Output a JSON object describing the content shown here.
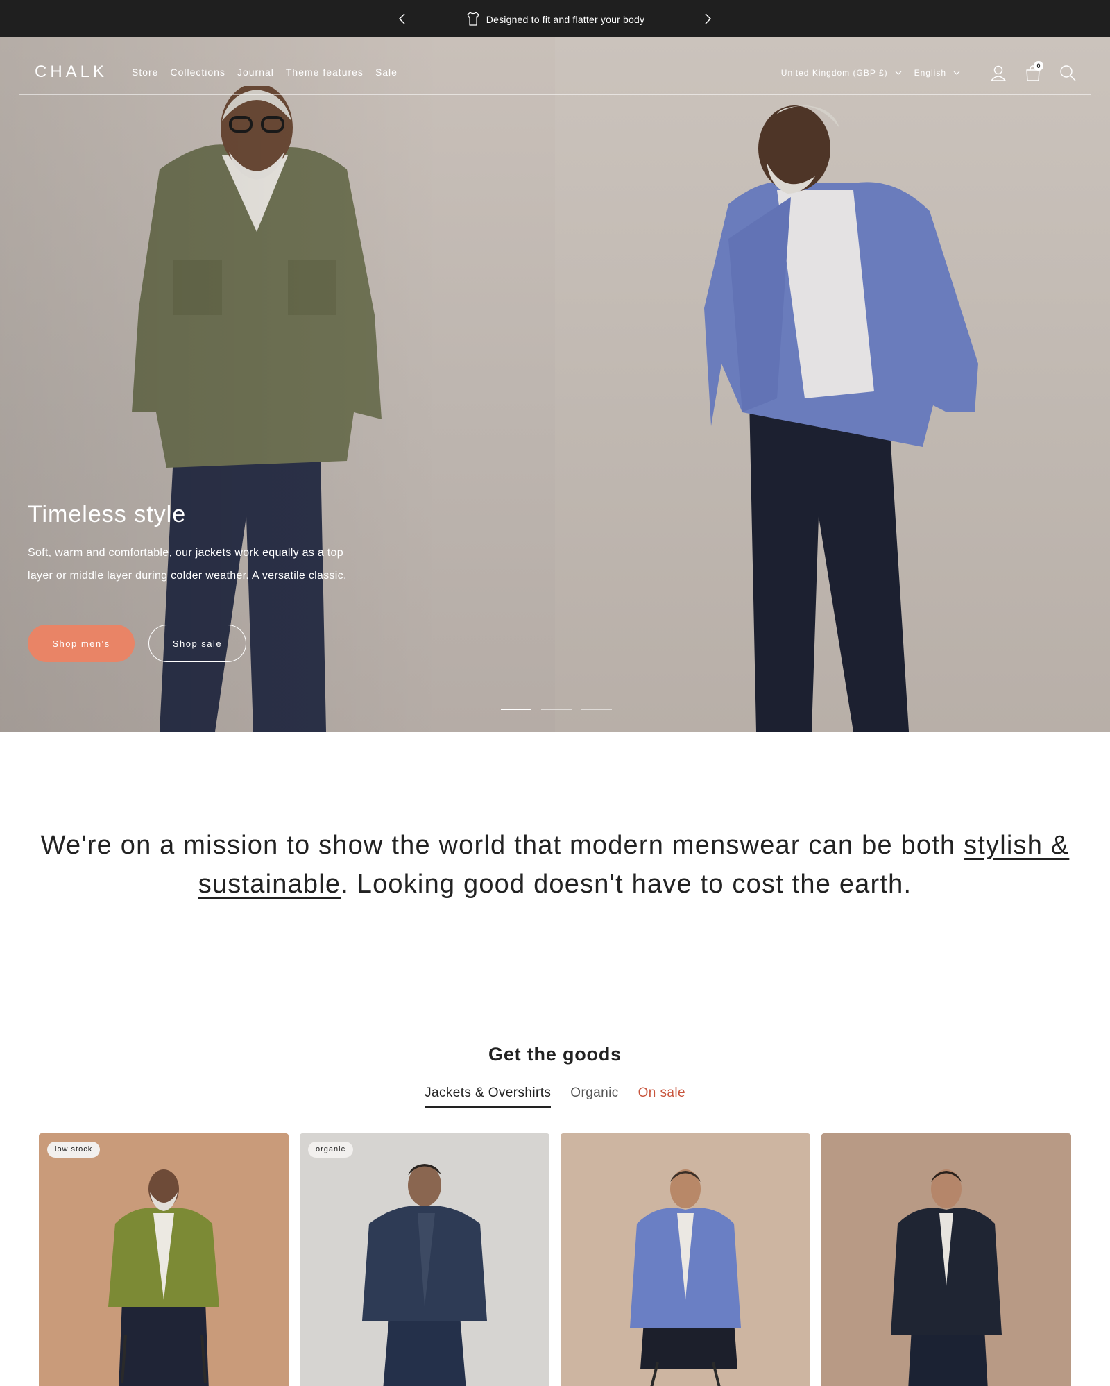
{
  "announcement": {
    "message": "Designed to fit and flatter your body",
    "icon": "tshirt-icon"
  },
  "header": {
    "logo": "CHALK",
    "nav": [
      "Store",
      "Collections",
      "Journal",
      "Theme features",
      "Sale"
    ],
    "country_selector": "United Kingdom (GBP £)",
    "language_selector": "English",
    "cart_count": "0",
    "icons": [
      "account-icon",
      "cart-icon",
      "search-icon"
    ]
  },
  "hero": {
    "title": "Timeless style",
    "description": "Soft, warm and comfortable, our jackets work equally as a top layer or middle layer during colder weather. A versatile classic.",
    "primary_button": "Shop men's",
    "secondary_button": "Shop sale",
    "slides_total": 3,
    "active_slide": 1
  },
  "mission": {
    "before": "We're on a mission to show the world that modern menswear can be both ",
    "link": "stylish & sustainable",
    "after": ". Looking good doesn't have to cost the earth."
  },
  "goods": {
    "title": "Get the goods",
    "tabs": [
      "Jackets & Overshirts",
      "Organic",
      "On sale"
    ],
    "active_tab": "Jackets & Overshirts",
    "products": [
      {
        "badge": "low stock",
        "background": "#c99b7a"
      },
      {
        "badge": "organic",
        "background": "#d6d4d1"
      },
      {
        "badge": "",
        "background": "#cdb5a1"
      },
      {
        "badge": "",
        "background": "#b89a85"
      }
    ]
  },
  "colors": {
    "accent": "#e98466",
    "sale": "#c8553d",
    "announcement_bg": "#1f1f1f"
  }
}
